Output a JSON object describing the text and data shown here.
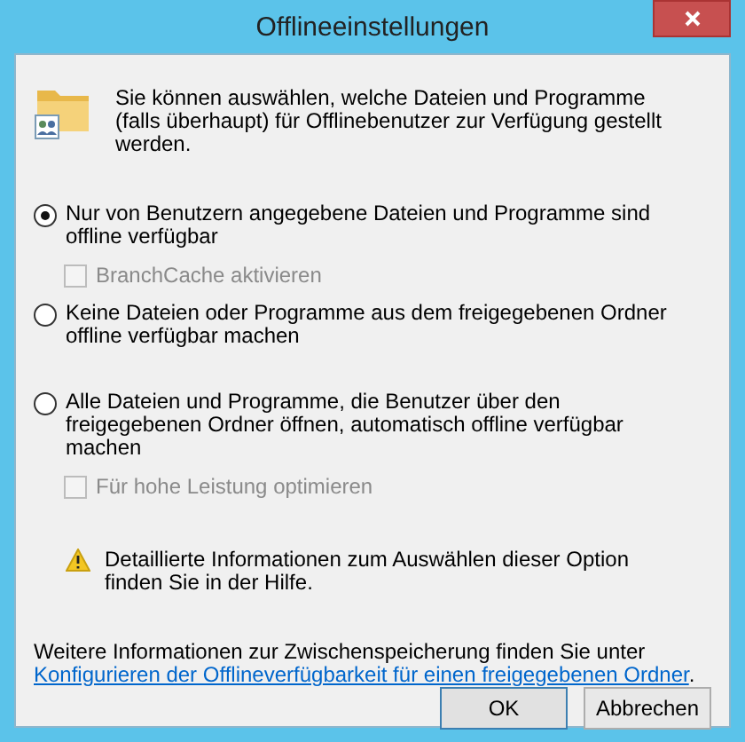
{
  "window": {
    "title": "Offlineeinstellungen"
  },
  "intro": "Sie können auswählen, welche Dateien und Programme (falls überhaupt) für Offlinebenutzer zur Verfügung gestellt werden.",
  "options": [
    {
      "label": "Nur von Benutzern angegebene Dateien und Programme sind offline verfügbar",
      "selected": true,
      "suboption": {
        "label": "BranchCache aktivieren",
        "checked": false,
        "disabled": true
      }
    },
    {
      "label": "Keine Dateien oder Programme aus dem freigegebenen Ordner offline verfügbar machen",
      "selected": false
    },
    {
      "label": "Alle Dateien und Programme, die Benutzer über den freigegebenen Ordner öffnen, automatisch offline verfügbar machen",
      "selected": false,
      "suboption": {
        "label": "Für hohe Leistung optimieren",
        "checked": false,
        "disabled": true
      }
    }
  ],
  "warning": "Detaillierte Informationen zum Auswählen dieser Option finden Sie in der Hilfe.",
  "info": {
    "text": "Weitere Informationen zur Zwischenspeicherung finden Sie unter",
    "link": "Konfigurieren der Offlineverfügbarkeit für einen freigegebenen Ordner",
    "end": "."
  },
  "buttons": [
    {
      "label": "OK",
      "default": true
    },
    {
      "label": "Abbrechen",
      "default": false
    }
  ]
}
